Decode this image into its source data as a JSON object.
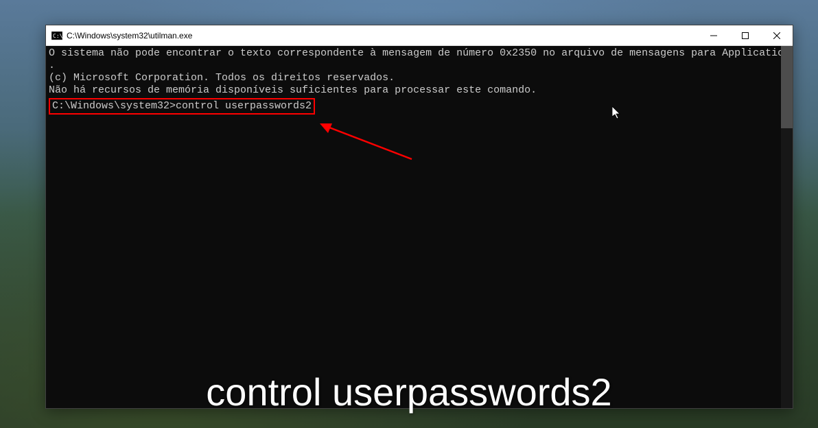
{
  "window": {
    "title": "C:\\Windows\\system32\\utilman.exe"
  },
  "console": {
    "line1": "O sistema não pode encontrar o texto correspondente à mensagem de número 0x2350 no arquivo de mensagens para Application",
    "line2": ".",
    "line3": "",
    "line4": "(c) Microsoft Corporation. Todos os direitos reservados.",
    "line5": "Não há recursos de memória disponíveis suficientes para processar este comando.",
    "line6": "",
    "prompt": "C:\\Windows\\system32>",
    "command": "control userpasswords2"
  },
  "caption": "control userpasswords2",
  "colors": {
    "highlight": "#ff0000",
    "console_bg": "#0c0c0c",
    "console_fg": "#cccccc"
  }
}
